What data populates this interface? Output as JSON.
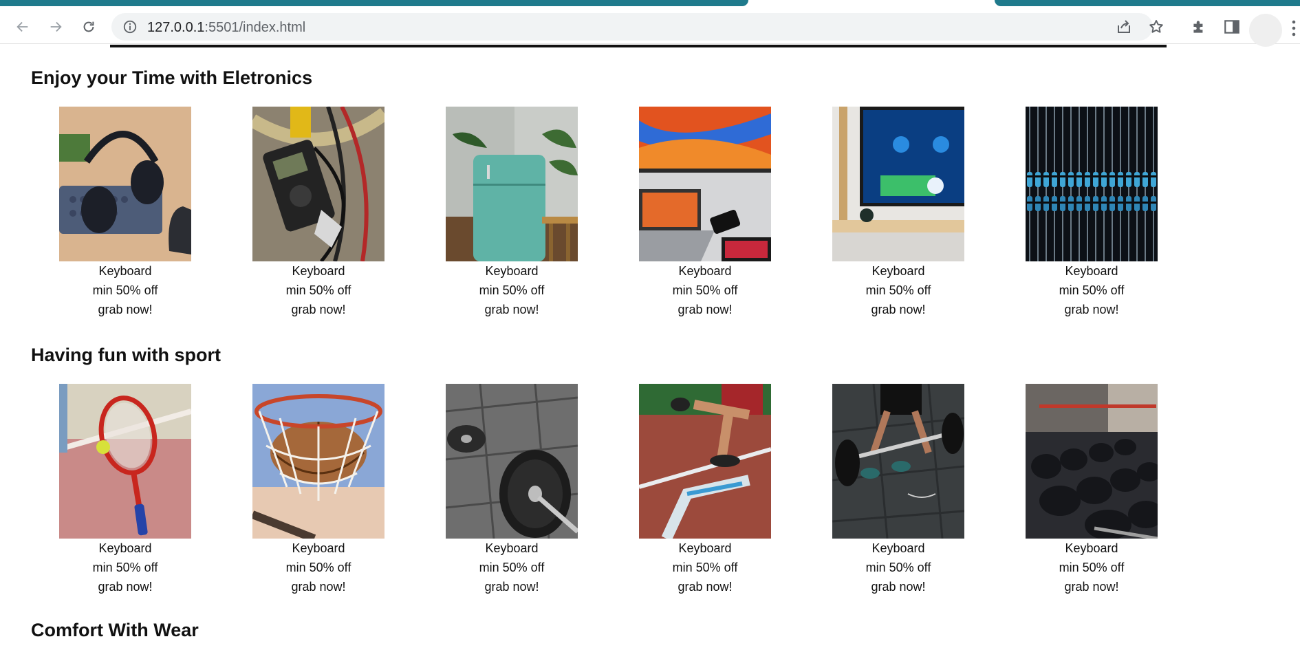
{
  "browser": {
    "url_host": "127.0.0.1",
    "url_rest": ":5501/index.html"
  },
  "sections": [
    {
      "title": "Enjoy your Time with Eletronics",
      "items": [
        {
          "name": "Keyboard",
          "offer": "min 50% off",
          "cta": "grab now!",
          "image": "headphones-keyboard-photo"
        },
        {
          "name": "Keyboard",
          "offer": "min 50% off",
          "cta": "grab now!",
          "image": "multimeter-wires-photo"
        },
        {
          "name": "Keyboard",
          "offer": "min 50% off",
          "cta": "grab now!",
          "image": "teal-fridge-photo"
        },
        {
          "name": "Keyboard",
          "offer": "min 50% off",
          "cta": "grab now!",
          "image": "laptop-monitor-photo"
        },
        {
          "name": "Keyboard",
          "offer": "min 50% off",
          "cta": "grab now!",
          "image": "smart-tv-photo"
        },
        {
          "name": "Keyboard",
          "offer": "min 50% off",
          "cta": "grab now!",
          "image": "resistors-photo"
        }
      ]
    },
    {
      "title": "Having fun with sport",
      "items": [
        {
          "name": "Keyboard",
          "offer": "min 50% off",
          "cta": "grab now!",
          "image": "tennis-racket-photo"
        },
        {
          "name": "Keyboard",
          "offer": "min 50% off",
          "cta": "grab now!",
          "image": "basketball-hoop-photo"
        },
        {
          "name": "Keyboard",
          "offer": "min 50% off",
          "cta": "grab now!",
          "image": "barbell-plate-photo"
        },
        {
          "name": "Keyboard",
          "offer": "min 50% off",
          "cta": "grab now!",
          "image": "running-track-photo"
        },
        {
          "name": "Keyboard",
          "offer": "min 50% off",
          "cta": "grab now!",
          "image": "deadlift-photo"
        },
        {
          "name": "Keyboard",
          "offer": "min 50% off",
          "cta": "grab now!",
          "image": "dumbbell-rack-photo"
        }
      ]
    },
    {
      "title": "Comfort With Wear",
      "items": []
    }
  ],
  "colors": {
    "tab_accent": "#1f7a8c",
    "omnibox_bg": "#f1f3f4"
  }
}
